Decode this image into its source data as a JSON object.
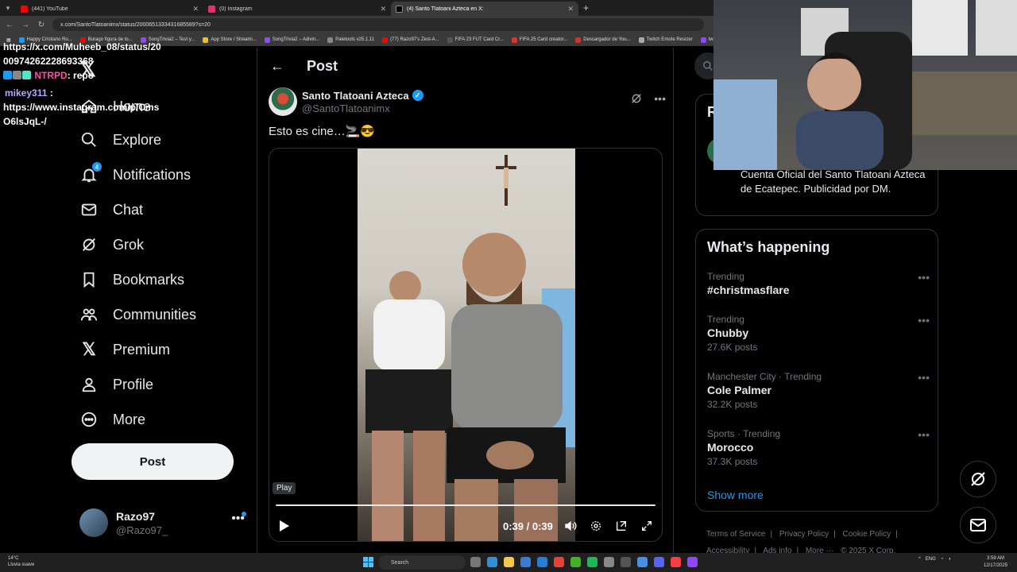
{
  "browser": {
    "tabs": [
      {
        "title": "(441) YouTube",
        "color": "#ff0000"
      },
      {
        "title": "(0) Instagram",
        "color": "#e1306c"
      },
      {
        "title": "(4) Santo Tlatoani Azteca en X: ",
        "color": "#ffffff"
      }
    ],
    "url": "x.com/SantoTlatoanimx/status/2000651333431685589?s=20",
    "bookmarks": [
      "Happy Cristiano Ro...",
      "Burago figura de to...",
      "SongTrivia2 – Test y...",
      "App Store / Streami...",
      "SongTrivia2 – Adivin...",
      "Paletools v25.1.11",
      "(77) Razo97's Zest-A...",
      "FIFA 23 FUT Card Cr...",
      "FIFA 25 Card creator...",
      "Descargador de You...",
      "Twitch Emote Resizer",
      "twitch em"
    ]
  },
  "chat": {
    "line1": "https://x.com/Muheeb_08/status/20",
    "line2": "00974262228693368",
    "user1": "NTRPD",
    "msg1": ": repo",
    "user2": "mikey311",
    "msg2": ":",
    "line3": "https://www.instagram.com/p/Cms",
    "line4": "O6lsJqL-/"
  },
  "nav": {
    "items": [
      {
        "label": "Home",
        "icon": "home-icon"
      },
      {
        "label": "Explore",
        "icon": "search-icon"
      },
      {
        "label": "Notifications",
        "icon": "bell-icon",
        "badge": "4"
      },
      {
        "label": "Chat",
        "icon": "mail-icon"
      },
      {
        "label": "Grok",
        "icon": "grok-icon"
      },
      {
        "label": "Bookmarks",
        "icon": "bookmark-icon"
      },
      {
        "label": "Communities",
        "icon": "communities-icon"
      },
      {
        "label": "Premium",
        "icon": "x-logo-icon"
      },
      {
        "label": "Profile",
        "icon": "person-icon"
      },
      {
        "label": "More",
        "icon": "more-circle-icon"
      }
    ],
    "post_label": "Post"
  },
  "account": {
    "name": "Razo97",
    "handle": "@Razo97_"
  },
  "main": {
    "header_title": "Post",
    "author_name": "Santo Tlatoani Azteca",
    "author_handle": "@SantoTlatoanimx",
    "tweet_text": "Esto es cine…🚬😎",
    "video": {
      "tooltip": "Play",
      "time": "0:39 / 0:39",
      "progress": 1.0
    }
  },
  "right": {
    "card_heading": "R",
    "bio": "Cuenta Oficial del Santo Tlatoani Azteca de Ecatepec. Publicidad por DM.",
    "trends_title": "What’s happening",
    "trends": [
      {
        "context": "Trending",
        "name": "#christmasflare",
        "posts": ""
      },
      {
        "context": "Trending",
        "name": "Chubby",
        "posts": "27.6K posts"
      },
      {
        "context": "Manchester City · Trending",
        "name": "Cole Palmer",
        "posts": "32.2K posts"
      },
      {
        "context": "Sports · Trending",
        "name": "Morocco",
        "posts": "37.3K posts"
      }
    ],
    "show_more": "Show more",
    "footer": [
      "Terms of Service",
      "|",
      "Privacy Policy",
      "|",
      "Cookie Policy",
      "|",
      "Accessibility",
      "|",
      "Ads info",
      "|",
      "More ···",
      "© 2025 X Corp."
    ]
  },
  "taskbar": {
    "temp": "14°C",
    "weather": "Lluvia suave",
    "search": "Search",
    "lang": "ENG",
    "time": "3:59 AM",
    "date": "12/17/2025"
  },
  "colors": {
    "accent": "#1d9bf0",
    "background": "#000000",
    "border": "#2f3336",
    "muted": "#71767b"
  }
}
